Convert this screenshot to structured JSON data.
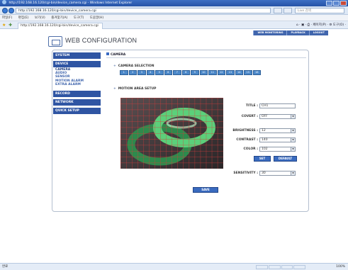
{
  "browser": {
    "window_title": "http://192.168.16.120/cgi-bin/device_camera.cgi - Windows Internet Explorer",
    "address": "http://192.168.16.120/cgi-bin/device_camera.cgi",
    "search_placeholder": "Live 검색",
    "menu": [
      "파일(F)",
      "편집(E)",
      "보기(V)",
      "즐겨찾기(A)",
      "도구(T)",
      "도움말(H)"
    ],
    "tab_title": "http://192.168.16.120/cgi-bin/device_camera.cgi",
    "tab_tools": "⌂ · ▣ · ⎙ · 페이지(P) · ⚙ 도구(O) ·",
    "status_left": "완료",
    "status_right": "100%"
  },
  "header": {
    "title": "WEB CONFIGURATION",
    "nav": [
      "WEB MONITORING",
      "PLAYBACK",
      "LOGOUT"
    ]
  },
  "sidebar": {
    "system": "SYSTEM",
    "device": "DEVICE",
    "device_items": [
      "CAMERA",
      "AUDIO",
      "SENSOR",
      "MOTION ALARM",
      "EXTRA ALARM"
    ],
    "record": "RECORD",
    "network": "NETWORK",
    "quick_setup": "QUICK SETUP"
  },
  "main": {
    "section_title": "CAMERA",
    "camera_selection_label": "CAMERA SELECTION",
    "camera_buttons": [
      "1",
      "2",
      "3",
      "4",
      "5",
      "6",
      "7",
      "8",
      "9",
      "10",
      "11",
      "12",
      "13",
      "14",
      "15",
      "16"
    ],
    "motion_area_label": "MOTION AREA SETUP",
    "title_label": "TITLE :",
    "title_value": "CH1",
    "covert_label": "COVERT :",
    "covert_value": "OFF",
    "brightness_label": "BRIGHTNESS :",
    "brightness_value": "12",
    "contrast_label": "CONTRAST :",
    "contrast_value": "140",
    "color_label": "COLOR :",
    "color_value": "102",
    "set_button": "SET",
    "default_button": "DEFAULT",
    "sensitivity_label": "SENSITIVITY :",
    "sensitivity_value": "30",
    "save_button": "SAVE"
  },
  "colors": {
    "nav_blue": "#2f55a3",
    "accent": "#3a6bbf",
    "grid_red": "#d83a3a",
    "ring_green": "#5bd07a"
  }
}
